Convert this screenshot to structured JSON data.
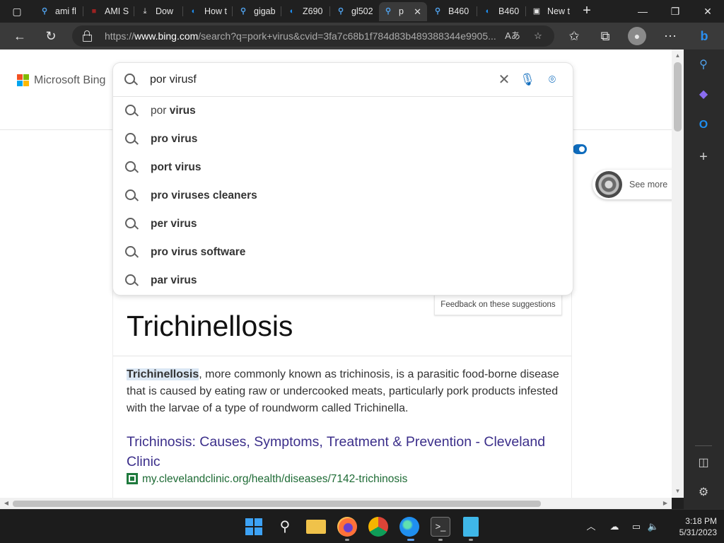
{
  "browser": {
    "tabs": [
      {
        "label": "ami fl",
        "icon": "bing-search-icon"
      },
      {
        "label": "AMI S",
        "icon": "pdf-icon"
      },
      {
        "label": "Dow",
        "icon": "download-icon"
      },
      {
        "label": "How t",
        "icon": "edge-site-icon"
      },
      {
        "label": "gigab",
        "icon": "bing-search-icon"
      },
      {
        "label": "Z690",
        "icon": "edge-site-icon"
      },
      {
        "label": "gl502",
        "icon": "bing-search-icon"
      },
      {
        "label": "p",
        "icon": "bing-search-icon",
        "active": true
      },
      {
        "label": "B460",
        "icon": "bing-search-icon"
      },
      {
        "label": "B460",
        "icon": "edge-site-icon"
      },
      {
        "label": "New t",
        "icon": "newtab-icon"
      }
    ],
    "url_prefix": "https://",
    "url_host": "www.bing.com",
    "url_rest": "/search?q=pork+virus&cvid=3fa7c68b1f784d83b489388344e9905..."
  },
  "bing": {
    "logo_text": "Microsoft Bing",
    "search_value": "por virusf",
    "suggestions": [
      {
        "normal": "por ",
        "bold": "virus"
      },
      {
        "normal": "",
        "bold": "pro virus"
      },
      {
        "normal": "",
        "bold": "port virus"
      },
      {
        "normal": "",
        "bold": "pro viruses cleaners"
      },
      {
        "normal": "",
        "bold": "per virus"
      },
      {
        "normal": "",
        "bold": "pro virus software"
      },
      {
        "normal": "",
        "bold": "par virus"
      }
    ],
    "feedback_label": "Feedback on these suggestions",
    "see_more_label": "See more"
  },
  "result": {
    "title": "Trichinellosis",
    "desc_highlight": "Trichinellosis",
    "desc_rest": ", more commonly known as trichinosis, is a parasitic food-borne disease that is caused by eating raw or undercooked meats, particularly pork products infested with the larvae of a type of roundworm called Trichinella.",
    "link_title": "Trichinosis: Causes, Symptoms, Treatment & Prevention - Cleveland Clinic",
    "link_url": "my.clevelandclinic.org/health/diseases/7142-trichinosis"
  },
  "taskbar": {
    "time": "3:18 PM",
    "date": "5/31/2023",
    "apps": [
      "start",
      "search",
      "file-explorer",
      "firefox",
      "chrome",
      "edge",
      "terminal",
      "notepad"
    ]
  },
  "colors": {
    "accent": "#0f6cbd",
    "link": "#3b2e8a",
    "url_green": "#1e6b35",
    "highlight": "#dbe7f4"
  }
}
